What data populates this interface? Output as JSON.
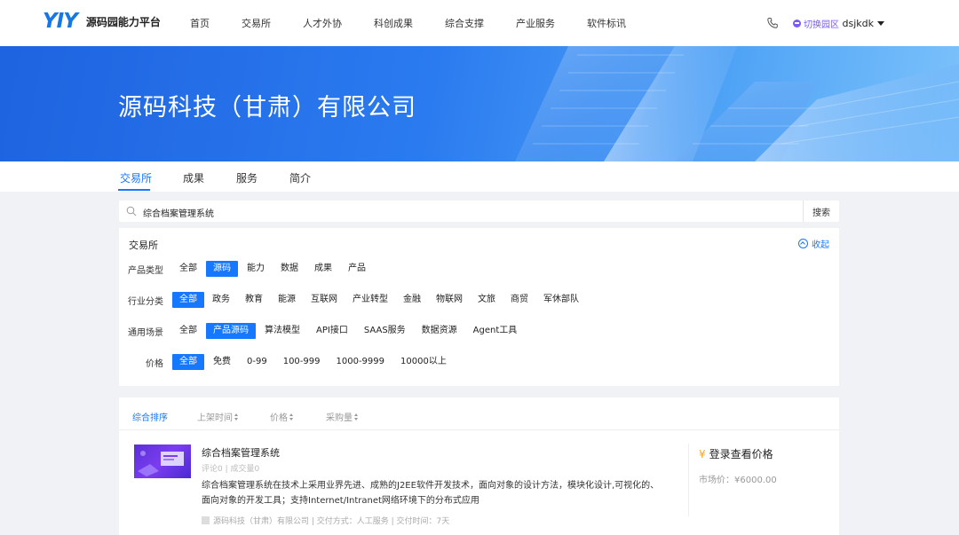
{
  "header": {
    "logo_mark": "YIY",
    "logo_text": "源码园能力平台",
    "nav": [
      "首页",
      "交易所",
      "人才外协",
      "科创成果",
      "综合支撑",
      "产业服务",
      "软件标讯"
    ],
    "switch_label": "切换园区",
    "username": "dsjkdk"
  },
  "banner": {
    "title": "源码科技（甘肃）有限公司"
  },
  "tabs": [
    {
      "label": "交易所",
      "active": true
    },
    {
      "label": "成果",
      "active": false
    },
    {
      "label": "服务",
      "active": false
    },
    {
      "label": "简介",
      "active": false
    }
  ],
  "search": {
    "value": "综合档案管理系统",
    "button": "搜索"
  },
  "filters": {
    "title": "交易所",
    "collapse_label": "收起",
    "rows": [
      {
        "label": "产品类型",
        "options": [
          "全部",
          "源码",
          "能力",
          "数据",
          "成果",
          "产品"
        ],
        "active": "源码"
      },
      {
        "label": "行业分类",
        "options": [
          "全部",
          "政务",
          "教育",
          "能源",
          "互联网",
          "产业转型",
          "金融",
          "物联网",
          "文旅",
          "商贸",
          "军休部队"
        ],
        "active": "全部"
      },
      {
        "label": "通用场景",
        "options": [
          "全部",
          "产品源码",
          "算法模型",
          "API接口",
          "SAAS服务",
          "数据资源",
          "Agent工具"
        ],
        "active": "产品源码"
      },
      {
        "label": "价格",
        "options": [
          "全部",
          "免费",
          "0-99",
          "100-999",
          "1000-9999",
          "10000以上"
        ],
        "active": "全部"
      }
    ]
  },
  "sort": {
    "items": [
      "综合排序",
      "上架时间",
      "价格",
      "采购量"
    ],
    "active": "综合排序"
  },
  "product": {
    "title": "综合档案管理系统",
    "meta": "评论0 | 成交量0",
    "desc": "综合档案管理系统在技术上采用业界先进、成熟的J2EE软件开发技术，面向对象的设计方法，模块化设计,可视化的、面向对象的开发工具；支持Internet/Intranet网络环境下的分布式应用",
    "footer": "源码科技（甘肃）有限公司 | 交付方式：人工服务 | 交付时间：7天",
    "price_login": "登录查看价格",
    "yen_symbol": "¥",
    "market_price": "市场价：¥6000.00"
  },
  "colors": {
    "primary": "#1677ff",
    "switch": "#7a5af5",
    "yen": "#f5a623"
  }
}
